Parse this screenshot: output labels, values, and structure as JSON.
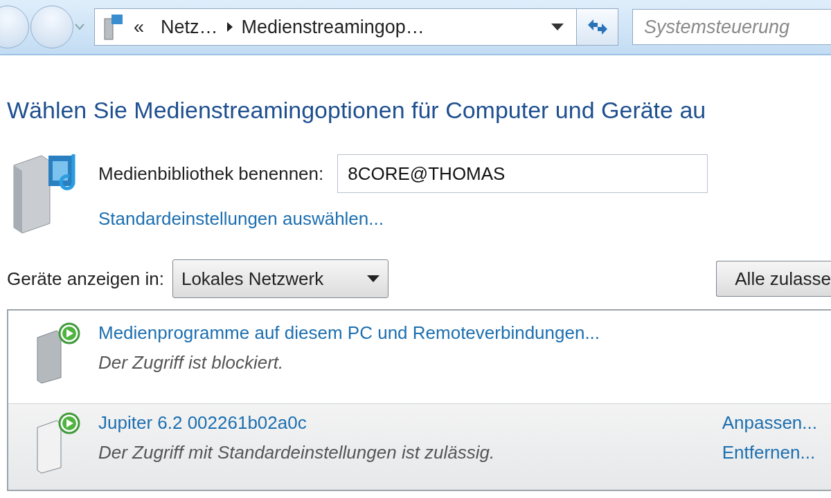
{
  "address_bar": {
    "overflow": "«",
    "crumbs": [
      {
        "label": "Netz…"
      },
      {
        "label": "Medienstreamingop…"
      }
    ]
  },
  "search": {
    "placeholder": "Systemsteuerung"
  },
  "heading": "Wählen Sie Medienstreamingoptionen für Computer und Geräte au",
  "library": {
    "label": "Medienbibliothek benennen:",
    "value": "8CORE@THOMAS",
    "link": "Standardeinstellungen auswählen..."
  },
  "filter": {
    "label": "Geräte anzeigen in:",
    "value": "Lokales Netzwerk"
  },
  "allow_all_button": "Alle zulasse",
  "devices": [
    {
      "name": "Medienprogramme auf diesem PC und Remoteverbindungen...",
      "status": "Der Zugriff ist blockiert.",
      "selected": false,
      "kind": "pc"
    },
    {
      "name": "Jupiter 6.2 002261b02a0c",
      "status": "Der Zugriff mit Standardeinstellungen ist zulässig.",
      "selected": true,
      "kind": "device",
      "actions": [
        "Anpassen...",
        "Entfernen..."
      ]
    }
  ]
}
